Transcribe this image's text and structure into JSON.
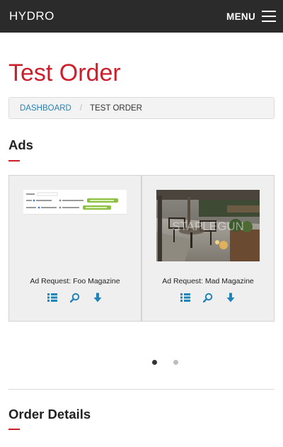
{
  "header": {
    "brand": "HYDRO",
    "menu_label": "MENU"
  },
  "page": {
    "title": "Test Order"
  },
  "breadcrumb": {
    "items": [
      {
        "label": "DASHBOARD",
        "link": true
      },
      {
        "label": "TEST ORDER",
        "link": false
      }
    ],
    "separator": "/"
  },
  "sections": {
    "ads_title": "Ads",
    "order_details_title": "Order Details"
  },
  "ads": [
    {
      "label": "Ad Request: Foo Magazine",
      "thumbnail_type": "form-screenshot",
      "actions": [
        "list-icon",
        "search-icon",
        "download-icon"
      ]
    },
    {
      "label": "Ad Request: Mad Magazine",
      "thumbnail_type": "patio-photo",
      "thumbnail_watermark": "STAPLEGUN",
      "actions": [
        "list-icon",
        "search-icon",
        "download-icon"
      ]
    }
  ],
  "carousel": {
    "pages": 2,
    "active_index": 0
  },
  "colors": {
    "topbar_bg": "#2b2b2b",
    "accent_red": "#cc1f2b",
    "link_blue": "#1f84b8",
    "card_bg": "#efefef"
  }
}
